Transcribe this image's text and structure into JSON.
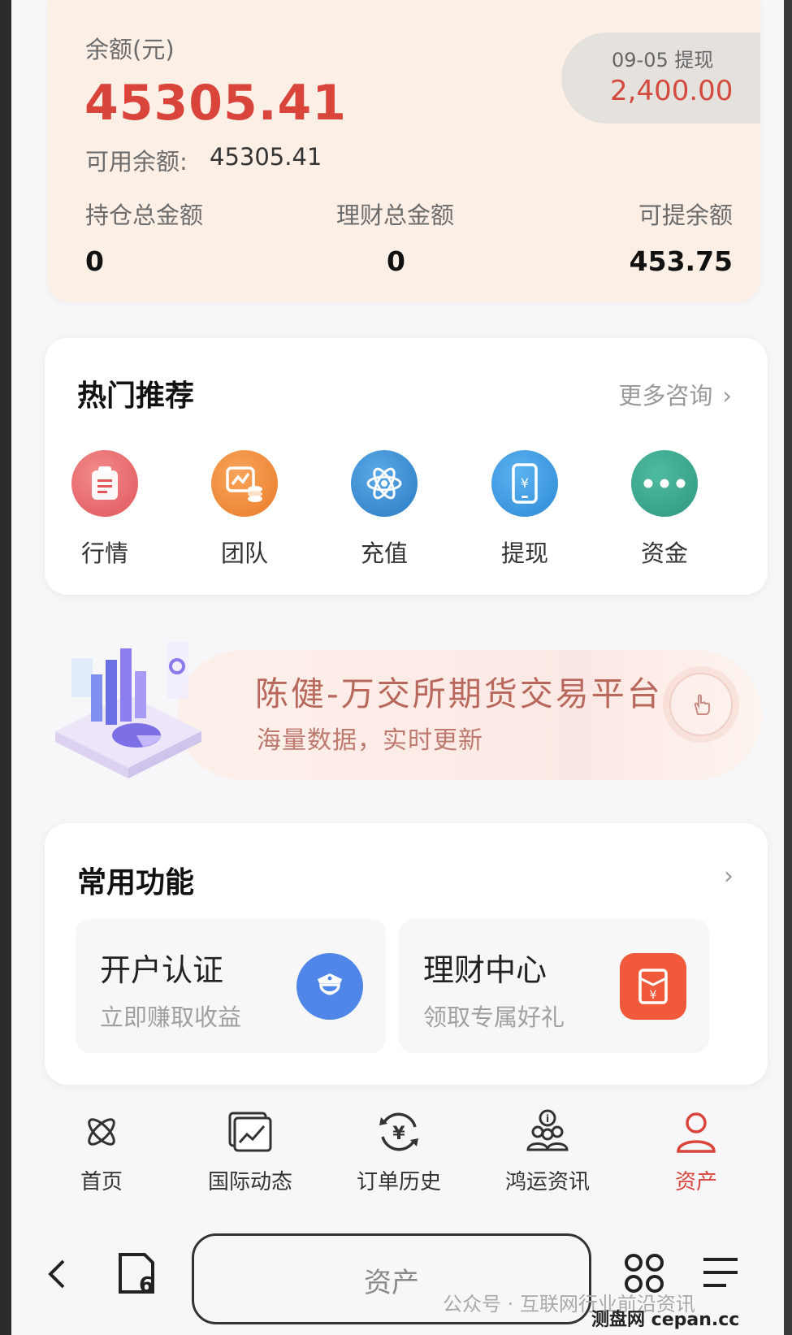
{
  "balance": {
    "label": "余额(元)",
    "value": "45305.41",
    "available_label": "可用余额:",
    "available_value": "45305.41",
    "withdraw": {
      "date": "09-05 提现",
      "amount": "2,400.00"
    },
    "stats": [
      {
        "label": "持仓总金额",
        "value": "0"
      },
      {
        "label": "理财总金额",
        "value": "0"
      },
      {
        "label": "可提余额",
        "value": "453.75"
      }
    ]
  },
  "hot": {
    "title": "热门推荐",
    "more": "更多咨询",
    "items": [
      {
        "label": "行情",
        "icon": "clipboard-icon",
        "color": "#e8676b"
      },
      {
        "label": "团队",
        "icon": "chart-coins-icon",
        "color": "#ef8a3c"
      },
      {
        "label": "充值",
        "icon": "atom-icon",
        "color": "#3a8ed4"
      },
      {
        "label": "提现",
        "icon": "phone-yen-icon",
        "color": "#3a97e0"
      },
      {
        "label": "资金",
        "icon": "more-dots-icon",
        "color": "#3ea58f"
      }
    ]
  },
  "banner": {
    "title": "陈健-万交所期货交易平台",
    "subtitle": "海量数据，实时更新"
  },
  "common": {
    "title": "常用功能",
    "features": [
      {
        "title": "开户认证",
        "subtitle": "立即赚取收益",
        "icon": "officer-icon",
        "color": "#4f86e8"
      },
      {
        "title": "理财中心",
        "subtitle": "领取专属好礼",
        "icon": "red-envelope-icon",
        "color": "#f05a3a"
      }
    ]
  },
  "tabs": [
    {
      "label": "首页",
      "icon": "atom-outline-icon"
    },
    {
      "label": "国际动态",
      "icon": "trend-chart-icon"
    },
    {
      "label": "订单历史",
      "icon": "yen-refresh-icon"
    },
    {
      "label": "鸿运资讯",
      "icon": "group-info-icon"
    },
    {
      "label": "资产",
      "icon": "user-icon",
      "active": true
    }
  ],
  "browser": {
    "address": "资产",
    "tab_count": "6"
  },
  "watermark": {
    "line1": "公众号 · 互联网行业前沿资讯",
    "line2": "测盘网  cepan.cc"
  },
  "colors": {
    "accent": "#d9453b",
    "card_bg": "#fbefe6"
  }
}
